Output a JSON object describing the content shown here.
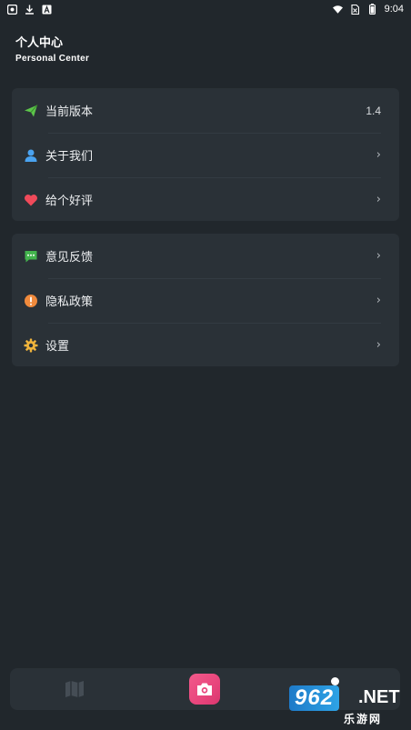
{
  "status_bar": {
    "time": "9:04",
    "left_icons": [
      "app-icon",
      "download-icon",
      "font-icon"
    ],
    "right_icons": [
      "wifi-icon",
      "no-sim-icon",
      "battery-icon"
    ]
  },
  "header": {
    "title": "个人中心",
    "subtitle": "Personal Center"
  },
  "menu_group_1": [
    {
      "icon": "paper-plane-icon",
      "label": "当前版本",
      "value": "1.4"
    },
    {
      "icon": "user-icon",
      "label": "关于我们",
      "chevron": "›"
    },
    {
      "icon": "heart-icon",
      "label": "给个好评",
      "chevron": "›"
    }
  ],
  "menu_group_2": [
    {
      "icon": "message-icon",
      "label": "意见反馈",
      "chevron": "›"
    },
    {
      "icon": "alert-icon",
      "label": "隐私政策",
      "chevron": "›"
    },
    {
      "icon": "gear-icon",
      "label": "设置",
      "chevron": "›"
    }
  ],
  "tab_bar": {
    "tabs": [
      "map-icon",
      "camera-icon",
      "profile-icon"
    ]
  },
  "watermark": {
    "brand": "962",
    "domain": ".NET",
    "sub": "乐游网"
  },
  "colors": {
    "background": "#21272c",
    "card": "#2a3137",
    "plane": "#5cc44a",
    "user": "#4aa3f0",
    "heart": "#f04a5a",
    "message": "#43b34d",
    "alert": "#f08a3c",
    "gear": "#f0b43c",
    "camera": "#ea4b80"
  }
}
